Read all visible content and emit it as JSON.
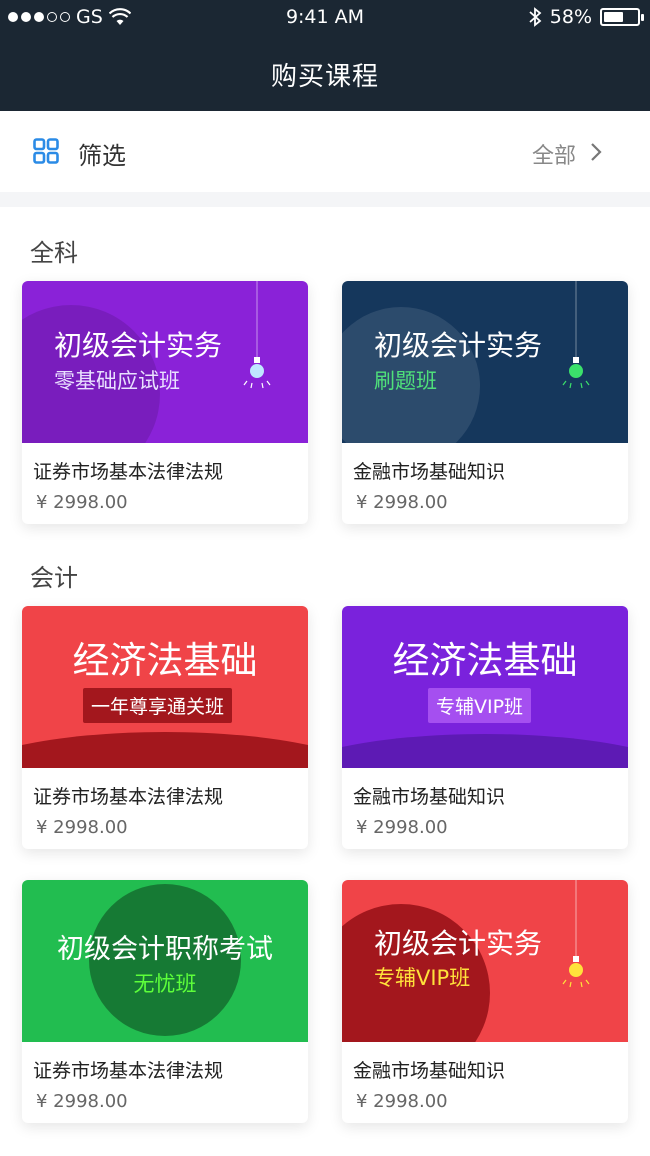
{
  "status_bar": {
    "carrier": "GS",
    "time": "9:41 AM",
    "battery": "58%",
    "battery_level": 0.58
  },
  "nav": {
    "title": "购买课程"
  },
  "filter": {
    "label": "筛选",
    "value": "全部"
  },
  "sections": [
    {
      "title": "全科",
      "cards": [
        {
          "banner_line1": "初级会计实务",
          "banner_line2": "零基础应试班",
          "name": "证券市场基本法律法规",
          "price": "¥ 2998.00",
          "theme": "#8a22d8"
        },
        {
          "banner_line1": "初级会计实务",
          "banner_line2": "刷题班",
          "name": "金融市场基础知识",
          "price": "¥ 2998.00",
          "theme": "#15375c"
        }
      ]
    },
    {
      "title": "会计",
      "cards": [
        {
          "banner_line1": "经济法基础",
          "banner_line2": "一年尊享通关班",
          "name": "证券市场基本法律法规",
          "price": "¥ 2998.00",
          "theme": "#f04448"
        },
        {
          "banner_line1": "经济法基础",
          "banner_line2": "专辅VIP班",
          "name": "金融市场基础知识",
          "price": "¥ 2998.00",
          "theme": "#7a22dc"
        },
        {
          "banner_line1": "初级会计职称考试",
          "banner_line2": "无忧班",
          "name": "证券市场基本法律法规",
          "price": "¥ 2998.00",
          "theme": "#22bd50"
        },
        {
          "banner_line1": "初级会计实务",
          "banner_line2": "专辅VIP班",
          "name": "金融市场基础知识",
          "price": "¥ 2998.00",
          "theme": "#f04448"
        }
      ]
    }
  ]
}
